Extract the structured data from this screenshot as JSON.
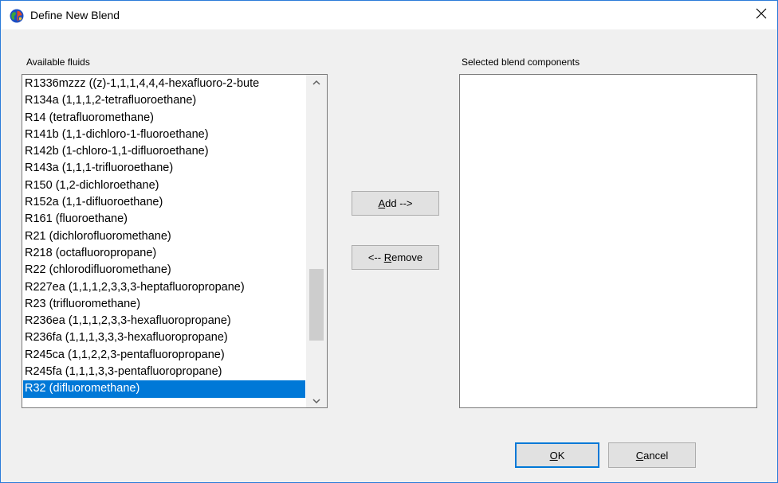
{
  "window": {
    "title": "Define New Blend"
  },
  "available": {
    "label": "Available fluids",
    "items": [
      "R1336mzzz ((z)-1,1,1,4,4,4-hexafluoro-2-bute",
      "R134a (1,1,1,2-tetrafluoroethane)",
      "R14 (tetrafluoromethane)",
      "R141b (1,1-dichloro-1-fluoroethane)",
      "R142b (1-chloro-1,1-difluoroethane)",
      "R143a (1,1,1-trifluoroethane)",
      "R150 (1,2-dichloroethane)",
      "R152a (1,1-difluoroethane)",
      "R161 (fluoroethane)",
      "R21 (dichlorofluoromethane)",
      "R218 (octafluoropropane)",
      "R22 (chlorodifluoromethane)",
      "R227ea (1,1,1,2,3,3,3-heptafluoropropane)",
      "R23 (trifluoromethane)",
      "R236ea (1,1,1,2,3,3-hexafluoropropane)",
      "R236fa (1,1,1,3,3,3-hexafluoropropane)",
      "R245ca (1,1,2,2,3-pentafluoropropane)",
      "R245fa (1,1,1,3,3-pentafluoropropane)",
      "R32 (difluoromethane)"
    ],
    "selected_index": 18
  },
  "selected_components": {
    "label": "Selected blend components"
  },
  "buttons": {
    "add_mnemonic": "A",
    "add_rest": "dd -->",
    "remove_prefix": "<-- ",
    "remove_mnemonic": "R",
    "remove_rest": "emove",
    "ok_mnemonic": "O",
    "ok_rest": "K",
    "cancel_mnemonic": "C",
    "cancel_rest": "ancel"
  },
  "colors": {
    "selection": "#0078d7",
    "window_border": "#2b7bd9"
  },
  "icons": {
    "app": "globe-icon",
    "close": "close-icon",
    "scroll_up": "chevron-up-icon",
    "scroll_down": "chevron-down-icon"
  }
}
